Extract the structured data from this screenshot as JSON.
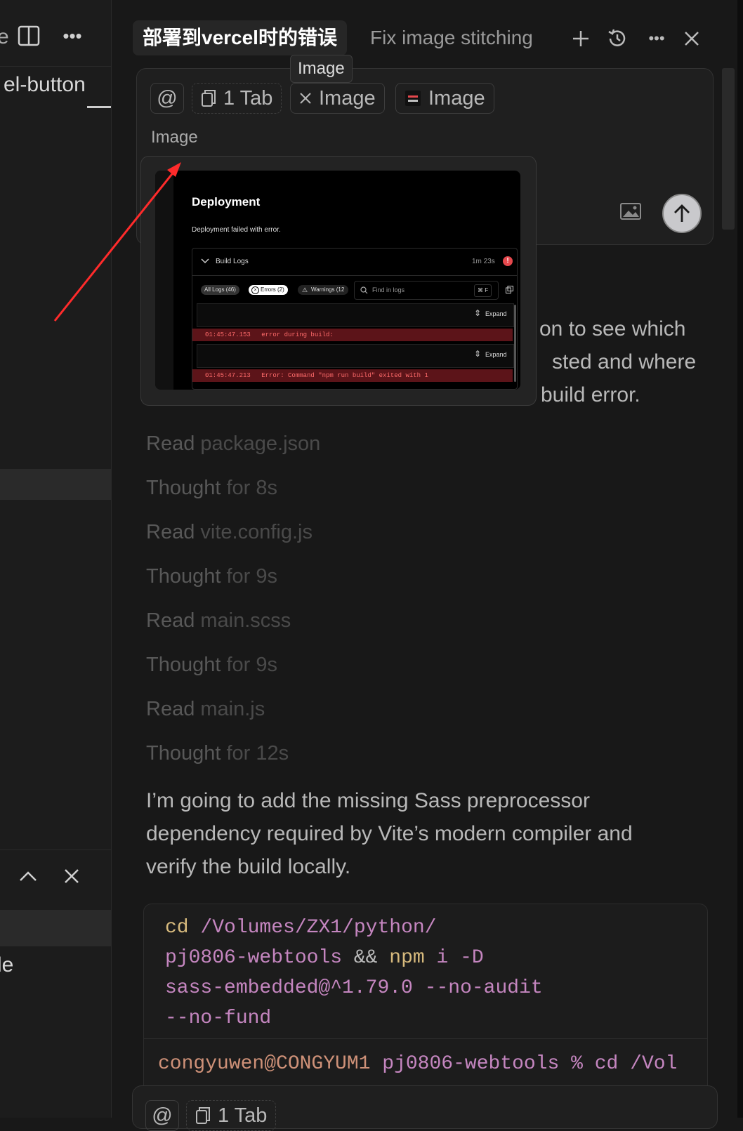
{
  "left_panel": {
    "tab_label_fragment": "e",
    "tab_label": "el-button",
    "search_fragment": "le"
  },
  "tabs": [
    {
      "label": "部署到vercel时的错误"
    },
    {
      "label": "Fix image stitching"
    }
  ],
  "tooltip": "Image",
  "composer": {
    "at_symbol": "@",
    "chips": [
      "1 Tab",
      "Image",
      "Image"
    ],
    "preview_heading": "Image"
  },
  "preview_screenshot": {
    "title": "Deployment",
    "subtitle": "Deployment failed with error.",
    "build_logs_label": "Build Logs",
    "duration": "1m 23s",
    "filters": [
      "All Logs (46)",
      "Errors (2)",
      "Warnings (12"
    ],
    "search_placeholder": "Find in logs",
    "shortcut": "⌘ F",
    "expand_label": "Expand",
    "log_lines": [
      {
        "time": "01:45:47.153",
        "text": "error during build:"
      },
      {
        "time": "01:45:47.213",
        "text": "Error: Command \"npm run build\" exited with 1"
      }
    ]
  },
  "hidden_paragraph_tail": [
    "on to see which",
    "sted and where",
    "build error."
  ],
  "steps": [
    {
      "verb": "Read",
      "obj": "package.json"
    },
    {
      "verb": "Thought",
      "obj": "for 8s"
    },
    {
      "verb": "Read",
      "obj": "vite.config.js"
    },
    {
      "verb": "Thought",
      "obj": "for 9s"
    },
    {
      "verb": "Read",
      "obj": "main.scss"
    },
    {
      "verb": "Thought",
      "obj": "for 9s"
    },
    {
      "verb": "Read",
      "obj": "main.js"
    },
    {
      "verb": "Thought",
      "obj": "for 12s"
    }
  ],
  "message": [
    "I’m going to add the missing Sass preprocessor",
    "dependency required by Vite’s modern compiler and",
    "verify the build locally."
  ],
  "code": {
    "line1_cmd": "cd",
    "line1_path": "/Volumes/ZX1/python/",
    "line2_path": "pj0806-webtools",
    "line2_op": "&&",
    "line2_cmd": "npm",
    "line2_args": "i -D",
    "line3": "sass-embedded@^1.79.0 --no-audit",
    "line4": "--no-fund",
    "terminal_user": "congyuwen@CONGYUM1",
    "terminal_dir": "pj0806-webtools",
    "terminal_prompt": "%",
    "terminal_cmd": "cd /Vol"
  },
  "bottom_composer": {
    "at_symbol": "@",
    "chip": "1 Tab"
  },
  "colors": {
    "accent_red": "#e5484d",
    "code_orange": "#ce9178",
    "code_purple": "#c586c0",
    "code_keyword": "#d7ba7d"
  }
}
